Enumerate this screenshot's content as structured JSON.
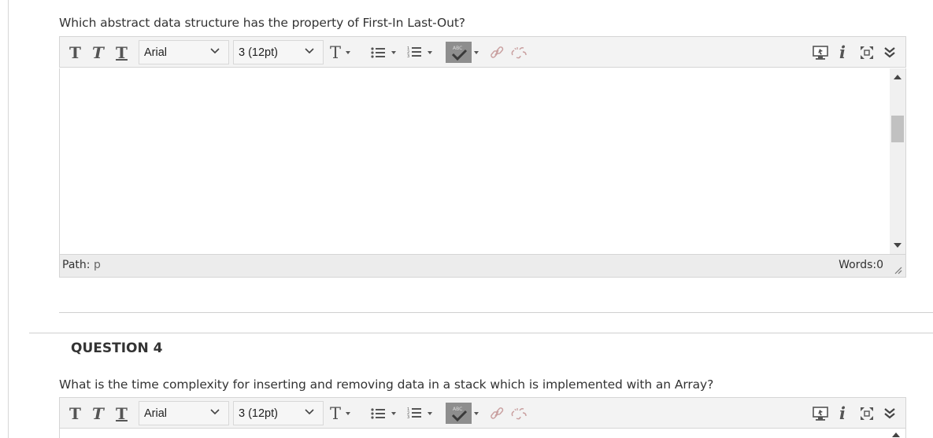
{
  "question3": {
    "text": "Which abstract data structure has the property of First-In Last-Out?",
    "toolbar": {
      "bold": "T",
      "italic": "T",
      "underline": "T",
      "font_family": "Arial",
      "font_size": "3 (12pt)",
      "text_color": "T",
      "spellcheck_badge": "ABC",
      "right_icons": [
        "preview-icon",
        "info-icon",
        "fullscreen-icon",
        "collapse-icon"
      ]
    },
    "path_label": "Path:",
    "path_value": "p",
    "words_label": "Words:0"
  },
  "question4": {
    "heading": "QUESTION 4",
    "text": "What is the time complexity for inserting and removing data in a stack which is implemented with an Array?",
    "toolbar": {
      "bold": "T",
      "italic": "T",
      "underline": "T",
      "font_family": "Arial",
      "font_size": "3 (12pt)",
      "text_color": "T",
      "spellcheck_badge": "ABC"
    }
  },
  "colors": {
    "toolbar_bg": "#f3f3f3",
    "border": "#d5d5d5",
    "statusbar_bg": "#ececec",
    "spellcheck_bg": "#8e8e8e",
    "link_icon_disabled": "#d9a8a8"
  }
}
